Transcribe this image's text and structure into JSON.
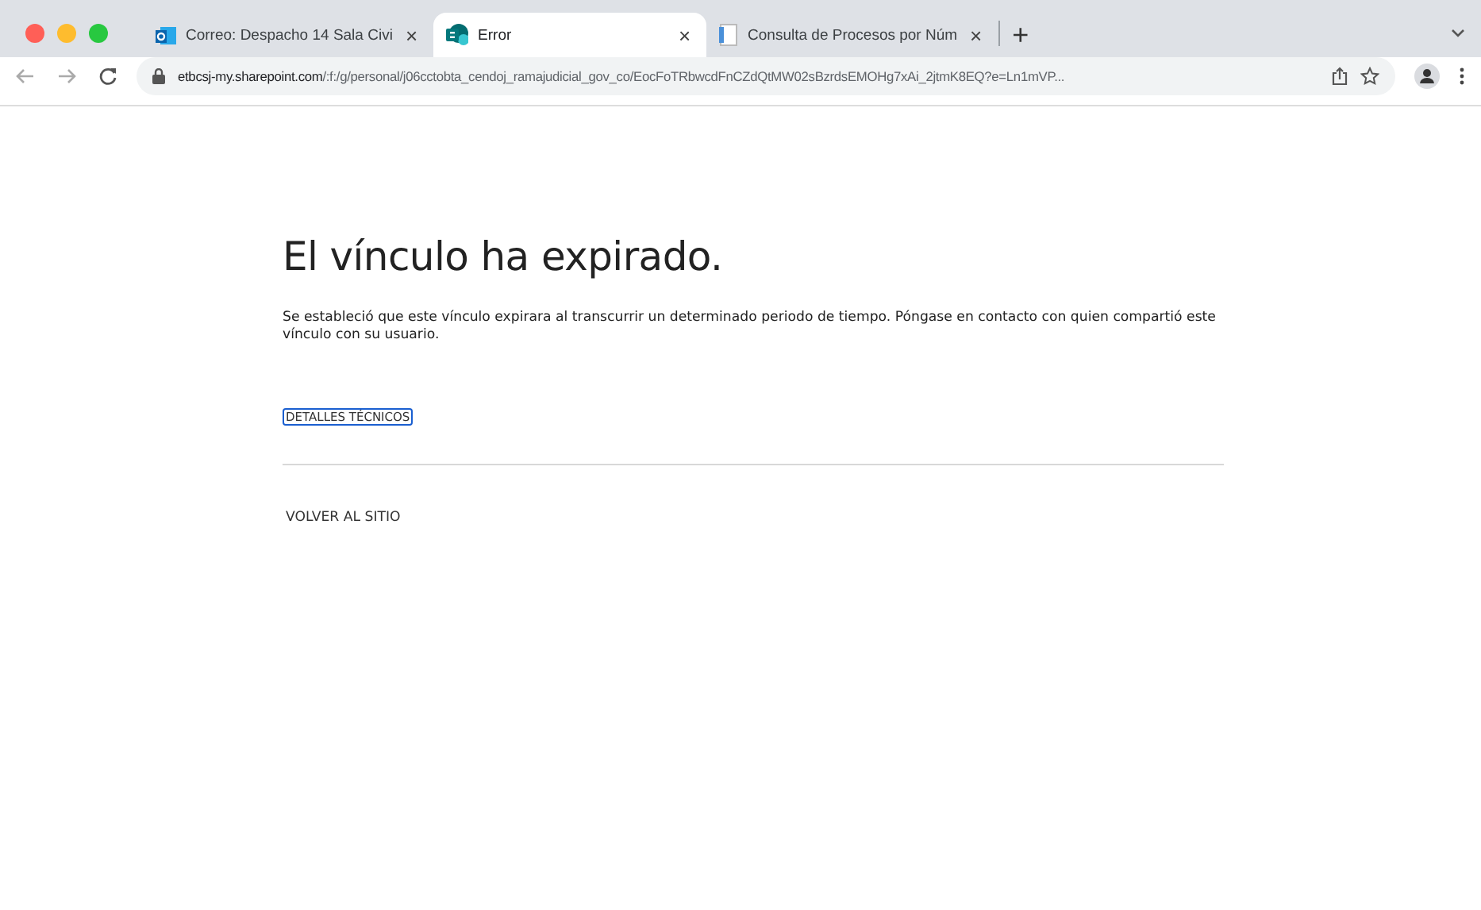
{
  "browser": {
    "tabs": [
      {
        "title": "Correo: Despacho 14 Sala Civi",
        "kind": "mail",
        "selected": false,
        "close": "×"
      },
      {
        "title": "Error",
        "kind": "sharepoint",
        "selected": true,
        "close": "×"
      },
      {
        "title": "Consulta de Procesos por Núm",
        "kind": "document",
        "selected": false,
        "close": "×"
      }
    ],
    "new_tab": "+",
    "url_host": "etbcsj-my.sharepoint.com",
    "url_path": "/:f:/g/personal/j06cctobta_cendoj_ramajudicial_gov_co/EocFoTRbwcdFnCZdQtMW02sBzrdsEMOHg7xAi_2jtmK8EQ?e=Ln1mVP..."
  },
  "page": {
    "heading": "El vínculo ha expirado.",
    "message": "Se estableció que este vínculo expirara al transcurrir un determinado periodo de tiempo. Póngase en contacto con quien compartió este vínculo con su usuario.",
    "details_link": {
      "label": "DETALLES TÉCNICOS",
      "focused": true
    },
    "back_link": "VOLVER AL SITIO"
  }
}
